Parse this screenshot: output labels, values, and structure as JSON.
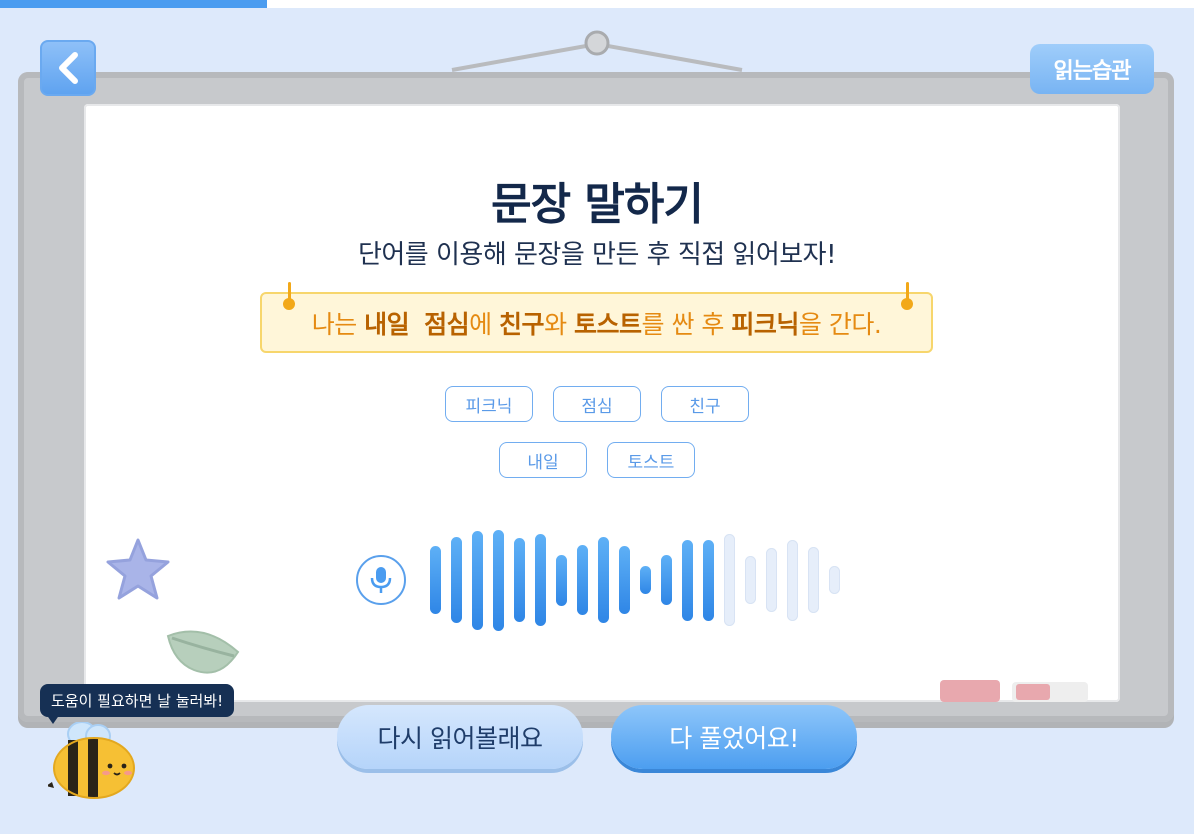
{
  "progress": {
    "percent": 22.4
  },
  "header": {
    "back_icon": "chevron-left-icon",
    "logo_text": "읽는습관"
  },
  "main": {
    "title": "문장 말하기",
    "subtitle": "단어를 이용해 문장을 만든 후 직접 읽어보자!",
    "sentence": [
      {
        "text": "나는 ",
        "bold": false
      },
      {
        "text": "내일",
        "bold": true
      },
      {
        "text": "  ",
        "bold": false
      },
      {
        "text": "점심",
        "bold": true
      },
      {
        "text": "에 ",
        "bold": false
      },
      {
        "text": "친구",
        "bold": true
      },
      {
        "text": "와 ",
        "bold": false
      },
      {
        "text": "토스트",
        "bold": true
      },
      {
        "text": "를 싼 후 ",
        "bold": false
      },
      {
        "text": "피크닉",
        "bold": true
      },
      {
        "text": "을 간다.",
        "bold": false
      }
    ],
    "word_chips": {
      "row1": [
        "피크닉",
        "점심",
        "친구"
      ],
      "row2": [
        "내일",
        "토스트"
      ]
    },
    "recording": {
      "icon": "microphone-icon",
      "waveform_levels": [
        0.62,
        0.78,
        0.9,
        0.92,
        0.76,
        0.84,
        0.46,
        0.64,
        0.78,
        0.62,
        0.25,
        0.45,
        0.74,
        0.74,
        0.84,
        0.44,
        0.58,
        0.74,
        0.6,
        0.25
      ],
      "active_bars": 14
    }
  },
  "actions": {
    "reread_label": "다시 읽어볼래요",
    "done_label": "다 풀었어요!"
  },
  "helper": {
    "bubble_text": "도움이 필요하면 날 눌러봐!",
    "icon": "bee-mascot-icon"
  },
  "colors": {
    "background": "#dde9fb",
    "accent": "#4a9cf0",
    "title": "#13284a",
    "sentence_text": "#e58a12",
    "sentence_bold": "#b86200",
    "sentence_bg": "#fff6d9"
  }
}
